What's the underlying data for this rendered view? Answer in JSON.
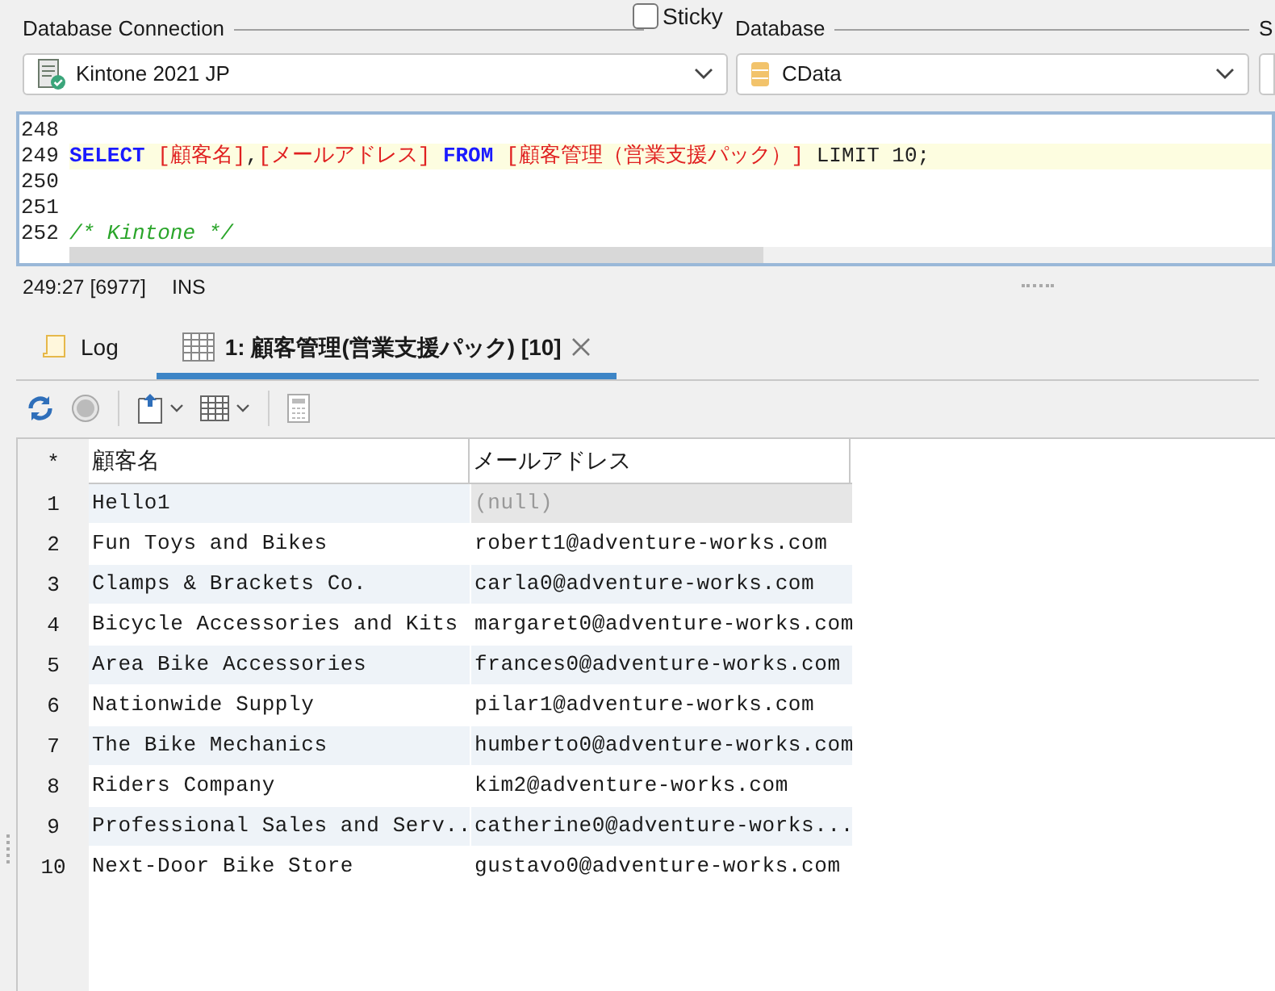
{
  "connection": {
    "label": "Database Connection",
    "value": "Kintone 2021 JP"
  },
  "sticky": {
    "label": "Sticky",
    "checked": false
  },
  "database": {
    "label": "Database",
    "value": "CData"
  },
  "column_3": {
    "label": "S"
  },
  "editor": {
    "lines": [
      {
        "number": "248"
      },
      {
        "number": "249",
        "current": true,
        "tokens": [
          {
            "kind": "keyword",
            "text": "SELECT"
          },
          {
            "kind": "identifier",
            "text": " [顧客名]"
          },
          {
            "kind": "plain",
            "text": ","
          },
          {
            "kind": "identifier",
            "text": "[メールアドレス]"
          },
          {
            "kind": "keyword",
            "text": " FROM"
          },
          {
            "kind": "identifier",
            "text": " [顧客管理（営業支援パック）]"
          },
          {
            "kind": "plain",
            "text": " LIMIT 10;"
          }
        ]
      },
      {
        "number": "250"
      },
      {
        "number": "251"
      },
      {
        "number": "252",
        "tokens": [
          {
            "kind": "comment",
            "text": "/* Kintone */"
          }
        ]
      }
    ]
  },
  "status_bar": {
    "position": "249:27 [6977]",
    "mode": "INS"
  },
  "tabs": [
    {
      "label": "Log",
      "kind": "log",
      "selected": false,
      "closable": false
    },
    {
      "label": "1: 顧客管理(営業支援パック) [10]",
      "kind": "result",
      "selected": true,
      "closable": true
    }
  ],
  "toolbar": [
    {
      "kind": "refresh",
      "disabled": false
    },
    {
      "kind": "stop",
      "disabled": true
    },
    {
      "kind": "export",
      "disabled": false
    },
    {
      "kind": "grid",
      "disabled": false
    },
    {
      "kind": "calculator",
      "disabled": true
    }
  ],
  "grid": {
    "corner": "*",
    "columns": [
      "顧客名",
      "メールアドレス"
    ],
    "rows": [
      {
        "number": "1",
        "cells": [
          {
            "text": "Hello1",
            "is_null": false
          },
          {
            "text": "(null)",
            "is_null": true
          }
        ]
      },
      {
        "number": "2",
        "cells": [
          {
            "text": "Fun Toys and Bikes",
            "is_null": false
          },
          {
            "text": "robert1@adventure-works.com",
            "is_null": false
          }
        ]
      },
      {
        "number": "3",
        "cells": [
          {
            "text": "Clamps & Brackets Co.",
            "is_null": false
          },
          {
            "text": "carla0@adventure-works.com",
            "is_null": false
          }
        ]
      },
      {
        "number": "4",
        "cells": [
          {
            "text": "Bicycle Accessories and Kits",
            "is_null": false
          },
          {
            "text": "margaret0@adventure-works.com",
            "is_null": false
          }
        ]
      },
      {
        "number": "5",
        "cells": [
          {
            "text": "Area Bike Accessories",
            "is_null": false
          },
          {
            "text": "frances0@adventure-works.com",
            "is_null": false
          }
        ]
      },
      {
        "number": "6",
        "cells": [
          {
            "text": "Nationwide Supply",
            "is_null": false
          },
          {
            "text": "pilar1@adventure-works.com",
            "is_null": false
          }
        ]
      },
      {
        "number": "7",
        "cells": [
          {
            "text": "The Bike Mechanics",
            "is_null": false
          },
          {
            "text": "humberto0@adventure-works.com",
            "is_null": false
          }
        ]
      },
      {
        "number": "8",
        "cells": [
          {
            "text": "Riders Company",
            "is_null": false
          },
          {
            "text": "kim2@adventure-works.com",
            "is_null": false
          }
        ]
      },
      {
        "number": "9",
        "cells": [
          {
            "text": "Professional Sales and Serv..",
            "is_null": false
          },
          {
            "text": "catherine0@adventure-works...",
            "is_null": false
          }
        ]
      },
      {
        "number": "10",
        "cells": [
          {
            "text": "Next-Door Bike Store",
            "is_null": false
          },
          {
            "text": "gustavo0@adventure-works.com",
            "is_null": false
          }
        ]
      }
    ]
  }
}
